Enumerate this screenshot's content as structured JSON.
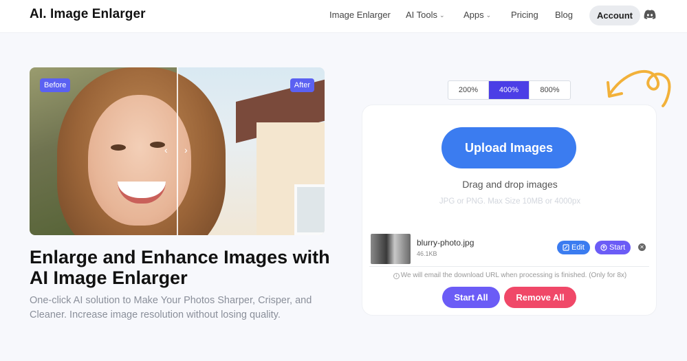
{
  "header": {
    "logo": "AI. Image Enlarger",
    "nav": [
      {
        "label": "Image Enlarger",
        "dropdown": false
      },
      {
        "label": "AI Tools",
        "dropdown": true
      },
      {
        "label": "Apps",
        "dropdown": true
      },
      {
        "label": "Pricing",
        "dropdown": false
      },
      {
        "label": "Blog",
        "dropdown": false
      }
    ],
    "account_label": "Account",
    "discord_icon": "discord-icon"
  },
  "hero": {
    "before_label": "Before",
    "after_label": "After",
    "headline": "Enlarge and Enhance Images with AI Image Enlarger",
    "subtext": "One-click AI solution to Make Your Photos Sharper, Crisper, and Cleaner. Increase image resolution without losing quality."
  },
  "scales": {
    "options": [
      "200%",
      "400%",
      "800%"
    ],
    "selected": "400%"
  },
  "upload": {
    "button_label": "Upload Images",
    "drag_text": "Drag and drop images",
    "hint": "JPG or PNG. Max Size 10MB or 4000px",
    "file": {
      "name": "blurry-photo.jpg",
      "size": "46.1KB",
      "edit_label": "Edit",
      "start_label": "Start"
    },
    "note": "We will email the download URL when processing is finished. (Only for 8x)",
    "start_all_label": "Start All",
    "remove_all_label": "Remove All"
  },
  "colors": {
    "accent": "#4b3ee6",
    "upload_blue": "#3b7cf0",
    "start_purple": "#6b5cf6",
    "remove_red": "#f04868",
    "squiggle_yellow": "#f2b13a"
  }
}
